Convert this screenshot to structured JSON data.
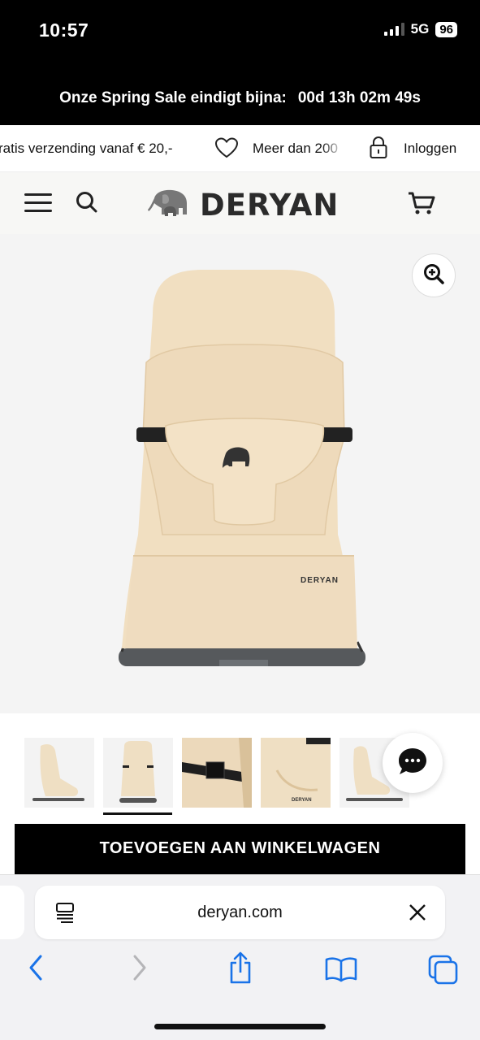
{
  "status_bar": {
    "time": "10:57",
    "network": "5G",
    "battery": "96"
  },
  "sale_banner": {
    "text": "Onze Spring Sale eindigt bijna:",
    "countdown": "00d 13h 02m 49s"
  },
  "usp_bar": {
    "shipping_visible": "ratis verzending vanaf € 20,-",
    "more_visible": "Meer dan 200",
    "login": "Inloggen",
    "icons": [
      "heart-icon",
      "lock-icon"
    ]
  },
  "header": {
    "brand": "DERYAN",
    "icons": [
      "menu-icon",
      "search-icon",
      "elephant-logo-icon",
      "cart-icon"
    ]
  },
  "product": {
    "brand_label": "DERYAN",
    "thumbnail_count": 5,
    "active_thumbnail": 2,
    "colors": {
      "fabric": "#f1dfc1",
      "frame": "#56595c"
    }
  },
  "actions": {
    "add_to_cart": "TOEVOEGEN AAN WINKELWAGEN"
  },
  "safari": {
    "url": "deryan.com",
    "icons": [
      "reader-icon",
      "close-icon",
      "back-icon",
      "forward-icon",
      "share-icon",
      "bookmarks-icon",
      "tabs-icon"
    ]
  },
  "colors": {
    "banner_bg": "#000000",
    "header_bg": "#f7f7f5",
    "safari_blue": "#1a73e8"
  }
}
